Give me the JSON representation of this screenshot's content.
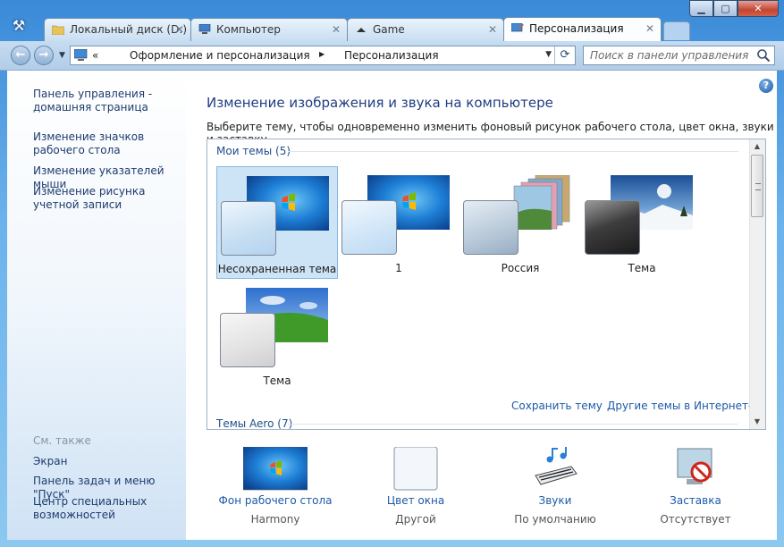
{
  "tabs": [
    {
      "label": "Локальный диск (D:)",
      "icon": "folder-icon"
    },
    {
      "label": "Компьютер",
      "icon": "computer-icon"
    },
    {
      "label": "Game",
      "icon": "folder-icon"
    },
    {
      "label": "Персонализация",
      "icon": "control-panel-icon",
      "active": true
    }
  ],
  "address": {
    "prefix": "«",
    "crumbs": [
      "Оформление и персонализация",
      "Персонализация"
    ]
  },
  "search": {
    "placeholder": "Поиск в панели управления"
  },
  "sidebar": {
    "links": [
      "Панель управления - домашняя страница",
      "Изменение значков рабочего стола",
      "Изменение указателей мыши",
      "Изменение рисунка учетной записи"
    ],
    "see_also_title": "См. также",
    "see_also": [
      "Экран",
      "Панель задач и меню \"Пуск\"",
      "Центр специальных возможностей"
    ]
  },
  "main": {
    "help": "?",
    "heading": "Изменение изображения и звука на компьютере",
    "description": "Выберите тему, чтобы одновременно изменить фоновый рисунок рабочего стола, цвет окна, звуки и заставку.",
    "my_themes_label": "Мои темы (5)",
    "aero_themes_label": "Темы Aero (7)",
    "themes": [
      {
        "label": "Несохраненная тема",
        "selected": true
      },
      {
        "label": "1"
      },
      {
        "label": "Россия"
      },
      {
        "label": "Тема"
      },
      {
        "label": "Тема"
      }
    ],
    "save_theme": "Сохранить тему",
    "more_themes": "Другие темы в Интернете"
  },
  "settings": [
    {
      "label": "Фон рабочего стола",
      "value": "Harmony",
      "icon": "desktop-background-icon"
    },
    {
      "label": "Цвет окна",
      "value": "Другой",
      "icon": "window-color-icon"
    },
    {
      "label": "Звуки",
      "value": "По умолчанию",
      "icon": "sounds-icon"
    },
    {
      "label": "Заставка",
      "value": "Отсутствует",
      "icon": "screensaver-icon"
    }
  ]
}
